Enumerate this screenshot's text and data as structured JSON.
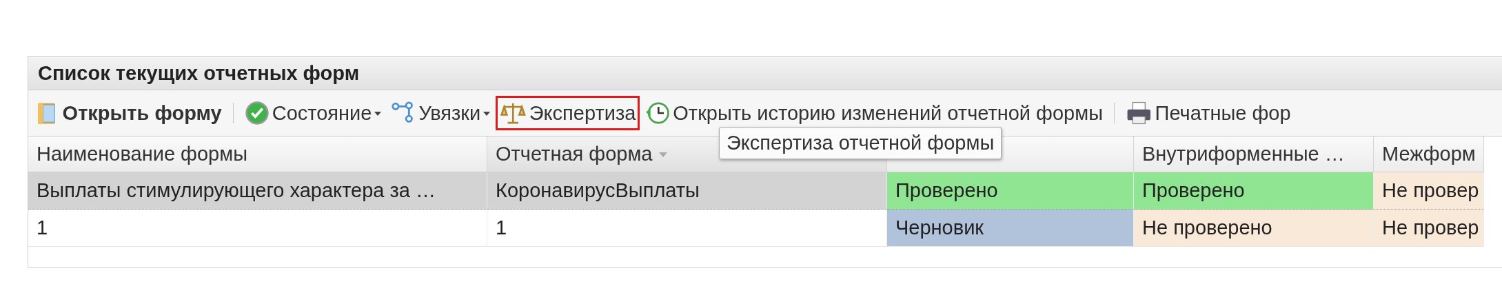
{
  "panel": {
    "title": "Список текущих отчетных форм"
  },
  "toolbar": [
    {
      "kind": "button",
      "label": "Открыть форму",
      "bold": true,
      "dropdown": false,
      "highlighted": false
    },
    {
      "kind": "separator"
    },
    {
      "kind": "button",
      "label": "Состояние",
      "bold": false,
      "dropdown": true,
      "highlighted": false
    },
    {
      "kind": "button",
      "label": "Увязки",
      "bold": false,
      "dropdown": true,
      "highlighted": false
    },
    {
      "kind": "button",
      "label": "Экспертиза",
      "bold": false,
      "dropdown": false,
      "highlighted": true
    },
    {
      "kind": "button",
      "label": "Открыть историю изменений отчетной формы",
      "bold": false,
      "dropdown": false,
      "highlighted": false
    },
    {
      "kind": "separator"
    },
    {
      "kind": "button",
      "label": "Печатные фор",
      "bold": false,
      "dropdown": false,
      "highlighted": false
    }
  ],
  "tooltip": {
    "text": "Экспертиза отчетной формы"
  },
  "table": {
    "columns": [
      {
        "label": "Наименование формы",
        "sorted": false
      },
      {
        "label": "Отчетная форма",
        "sorted": true
      },
      {
        "sorted": false
      },
      {
        "label": "Внутриформенные …",
        "sorted": false
      },
      {
        "label": "Межформ",
        "sorted": false
      }
    ],
    "rows": [
      {
        "selected": true,
        "cells": [
          {
            "text": "Выплаты стимулирующего характера за …"
          },
          {
            "text": "КоронавирусВыплаты"
          },
          {
            "text": "Проверено",
            "color": "#90e592"
          },
          {
            "text": "Проверено",
            "color": "#90e592"
          },
          {
            "text": "Не провер",
            "color": "#f8e9d9"
          }
        ]
      },
      {
        "selected": false,
        "cells": [
          {
            "text": "1"
          },
          {
            "text": "1"
          },
          {
            "text": "Черновик",
            "color": "#b0c3da"
          },
          {
            "text": "Не проверено",
            "color": "#f8e9d9"
          },
          {
            "text": "Не провер",
            "color": "#f8e9d9"
          }
        ]
      }
    ]
  }
}
